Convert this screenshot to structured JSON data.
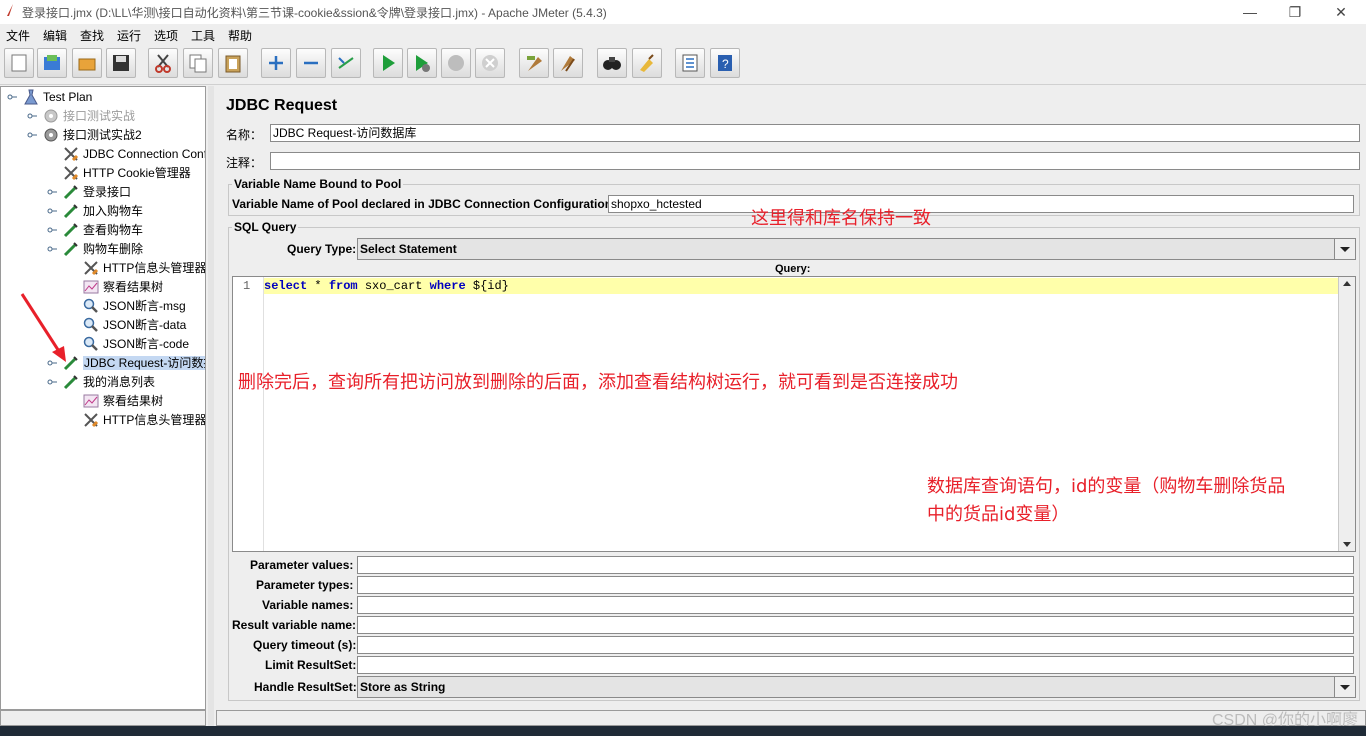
{
  "window": {
    "title": "登录接口.jmx (D:\\LL\\华测\\接口自动化资料\\第三节课-cookie&ssion&令牌\\登录接口.jmx) - Apache JMeter (5.4.3)",
    "minimize": "—",
    "maximize": "❐",
    "close": "✕"
  },
  "menu": [
    "文件",
    "编辑",
    "查找",
    "运行",
    "选项",
    "工具",
    "帮助"
  ],
  "toolbar": {
    "icons": [
      "new-icon",
      "templates-icon",
      "open-icon",
      "save-icon",
      "cut-icon",
      "copy-icon",
      "paste-icon",
      "expand-icon",
      "collapse-icon",
      "toggle-icon",
      "start-icon",
      "start-no-pause-icon",
      "stop-icon",
      "shutdown-icon",
      "clear-icon",
      "clear-all-icon",
      "search-icon",
      "reset-search-icon",
      "function-helper-icon",
      "help-icon"
    ]
  },
  "tree": {
    "nodes": [
      {
        "label": "Test Plan",
        "icon": "testplan-icon",
        "state": "normal"
      },
      {
        "label": "接口测试实战",
        "icon": "thread-group-icon",
        "state": "disabled"
      },
      {
        "label": "接口测试实战2",
        "icon": "thread-group-icon",
        "state": "normal"
      },
      {
        "label": "JDBC Connection Configuration",
        "icon": "config-wrench-icon",
        "state": "normal"
      },
      {
        "label": "HTTP Cookie管理器",
        "icon": "config-wrench-icon",
        "state": "normal"
      },
      {
        "label": "登录接口",
        "icon": "sampler-pipette-icon",
        "state": "normal"
      },
      {
        "label": "加入购物车",
        "icon": "sampler-pipette-icon",
        "state": "normal"
      },
      {
        "label": "查看购物车",
        "icon": "sampler-pipette-icon",
        "state": "normal"
      },
      {
        "label": "购物车删除",
        "icon": "sampler-pipette-icon",
        "state": "normal"
      },
      {
        "label": "HTTP信息头管理器",
        "icon": "config-wrench-icon",
        "state": "normal"
      },
      {
        "label": "察看结果树",
        "icon": "listener-chart-icon",
        "state": "normal"
      },
      {
        "label": "JSON断言-msg",
        "icon": "assertion-magnifier-icon",
        "state": "normal"
      },
      {
        "label": "JSON断言-data",
        "icon": "assertion-magnifier-icon",
        "state": "normal"
      },
      {
        "label": "JSON断言-code",
        "icon": "assertion-magnifier-icon",
        "state": "normal"
      },
      {
        "label": "JDBC Request-访问数据库",
        "icon": "sampler-pipette-icon",
        "state": "selected"
      },
      {
        "label": "我的消息列表",
        "icon": "sampler-pipette-icon",
        "state": "normal"
      },
      {
        "label": "察看结果树",
        "icon": "listener-chart-icon",
        "state": "normal"
      },
      {
        "label": "HTTP信息头管理器",
        "icon": "config-wrench-icon",
        "state": "normal"
      }
    ]
  },
  "panel": {
    "title": "JDBC Request",
    "name_label": "名称：",
    "name_value": "JDBC Request-访问数据库",
    "comment_label": "注释：",
    "comment_value": "",
    "pool_group_title": "Variable Name Bound to Pool",
    "pool_label": "Variable Name of Pool declared in JDBC Connection Configuration:",
    "pool_value": "shopxo_hctested",
    "sql_group_title": "SQL Query",
    "query_type_label": "Query Type:",
    "query_type_value": "Select Statement",
    "query_label": "Query:",
    "query_line_number": "1",
    "query_code": {
      "kw1": "select",
      "p1": " * ",
      "kw2": "from",
      "p2": " sxo_cart ",
      "kw3": "where",
      "p3": " ${id}"
    },
    "params": [
      {
        "label": "Parameter values:",
        "value": ""
      },
      {
        "label": "Parameter types:",
        "value": ""
      },
      {
        "label": "Variable names:",
        "value": ""
      },
      {
        "label": "Result variable name:",
        "value": ""
      },
      {
        "label": "Query timeout (s):",
        "value": ""
      },
      {
        "label": "Limit ResultSet:",
        "value": ""
      }
    ],
    "handle_label": "Handle ResultSet:",
    "handle_value": "Store as String"
  },
  "annotations": {
    "pool_note": "这里得和库名保持一致",
    "main_note": "删除完后，查询所有把访问放到删除的后面，添加查看结构树运行，就可看到是否连接成功",
    "query_note_line1": "数据库查询语句，id的变量（购物车删除货品",
    "query_note_line2": "中的货品id变量）"
  },
  "watermark": "CSDN @你的小啊廖",
  "colors": {
    "selected": "#c4d8f2",
    "annotation": "#e8202a",
    "code_keyword": "#0000c0",
    "current_line": "#ffffaa"
  }
}
